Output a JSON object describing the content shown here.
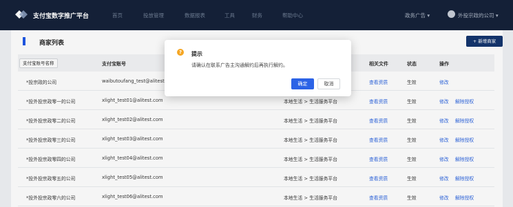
{
  "header": {
    "brand": "支付宝数字推广平台",
    "nav": [
      "首页",
      "投放管理",
      "数据报表",
      "工具",
      "财务",
      "帮助中心"
    ],
    "ad_menu": "政务广告 ▾",
    "user": "外投宗政的公司 ▾"
  },
  "page": {
    "title": "商家列表",
    "add_button": "+ 新增商家"
  },
  "table": {
    "columns": [
      "支付宝账号名称",
      "支付宝账号",
      "行业",
      "相关文件",
      "状态",
      "操作"
    ],
    "rows": [
      {
        "name": "*投宗政的公司",
        "account": "waibutoufang_test@alitest.com",
        "industry": "",
        "file": "查看资质",
        "status": "生效",
        "edit": "修改",
        "unbind": ""
      },
      {
        "name": "*投外投宗政零一的公司",
        "account": "xlight_test01@alitest.com",
        "industry": "本地生活 > 生活服务平台",
        "file": "查看资质",
        "status": "生效",
        "edit": "修改",
        "unbind": "解除授权"
      },
      {
        "name": "*投外投宗政零二的公司",
        "account": "xlight_test02@alitest.com",
        "industry": "本地生活 > 生活服务平台",
        "file": "查看资质",
        "status": "生效",
        "edit": "修改",
        "unbind": "解除授权"
      },
      {
        "name": "*投外投宗政零三的公司",
        "account": "xlight_test03@alitest.com",
        "industry": "本地生活 > 生活服务平台",
        "file": "查看资质",
        "status": "生效",
        "edit": "修改",
        "unbind": "解除授权"
      },
      {
        "name": "*投外投宗政零四的公司",
        "account": "xlight_test04@alitest.com",
        "industry": "本地生活 > 生活服务平台",
        "file": "查看资质",
        "status": "生效",
        "edit": "修改",
        "unbind": "解除授权"
      },
      {
        "name": "*投外投宗政零五的公司",
        "account": "xlight_test05@alitest.com",
        "industry": "本地生活 > 生活服务平台",
        "file": "查看资质",
        "status": "生效",
        "edit": "修改",
        "unbind": "解除授权"
      },
      {
        "name": "*投外投宗政零六的公司",
        "account": "xlight_test06@alitest.com",
        "industry": "本地生活 > 生活服务平台",
        "file": "查看资质",
        "status": "生效",
        "edit": "修改",
        "unbind": "解除授权"
      }
    ]
  },
  "dialog": {
    "icon": "?",
    "title": "提示",
    "message": "请确认在联系广告主沟通解约后再执行解约。",
    "ok": "确定",
    "cancel": "取消"
  },
  "colors": {
    "topbar": "#15223a",
    "accent": "#1f58e6",
    "link": "#2f67e0",
    "warning": "#f5a623"
  }
}
